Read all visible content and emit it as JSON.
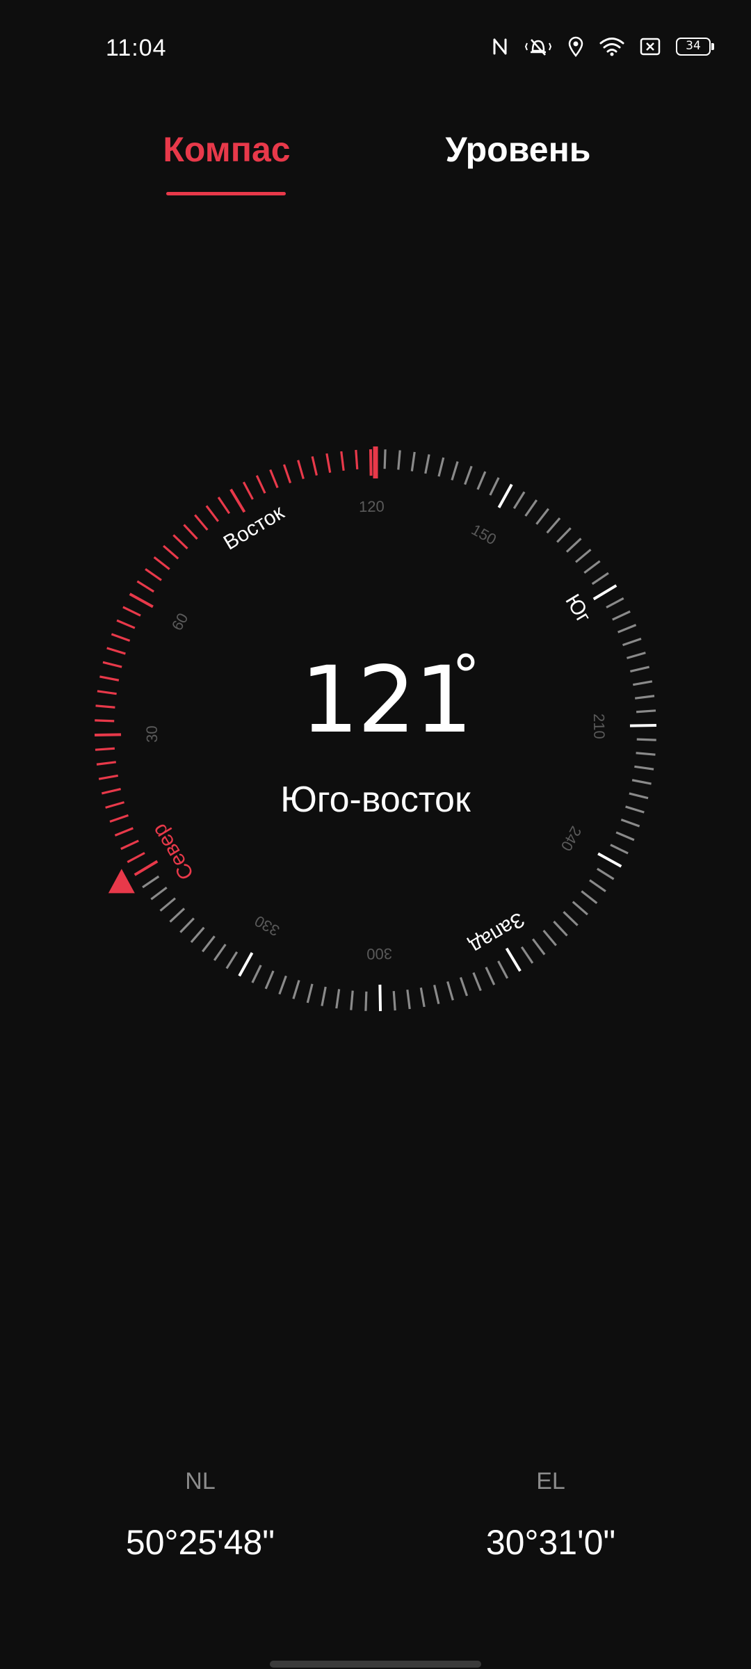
{
  "status_bar": {
    "time": "11:04",
    "battery_level": "34",
    "icons": [
      "nfc-icon",
      "vibrate-icon",
      "location-icon",
      "wifi-icon",
      "no-sim-icon",
      "battery-icon"
    ]
  },
  "tabs": [
    {
      "label": "Компас",
      "active": true
    },
    {
      "label": "Уровень",
      "active": false
    }
  ],
  "compass": {
    "heading_value": "121",
    "heading_degree_symbol": "°",
    "direction_label": "Юго-восток",
    "cardinal_labels": {
      "north": "Север",
      "east": "Восток",
      "south": "Юг",
      "west": "Запад"
    },
    "degree_labels": [
      "30",
      "60",
      "120",
      "150",
      "210",
      "240",
      "300",
      "330"
    ],
    "heading_degrees": 121,
    "colors": {
      "accent": "#e8394a",
      "tick": "#8a8a8a",
      "major_tick": "#ffffff",
      "degree_label": "#5a5a5a"
    }
  },
  "coordinates": {
    "lat_label": "NL",
    "lat_value": "50°25'48\"",
    "lon_label": "EL",
    "lon_value": "30°31'0\""
  }
}
